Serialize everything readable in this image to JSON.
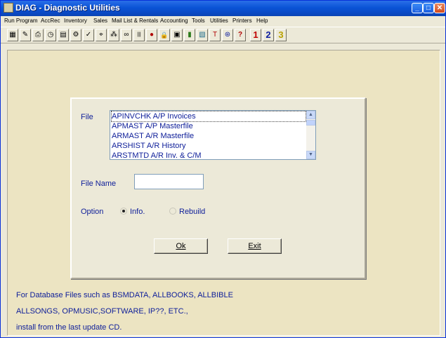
{
  "window": {
    "title": "DIAG - Diagnostic Utilities"
  },
  "caption": {
    "minimize": "_",
    "maximize": "□",
    "close": "✕"
  },
  "menu": [
    "Run Program",
    "AccRec",
    "Inventory",
    "Sales",
    "Mail List & Rentals",
    "Accounting",
    "Tools",
    "Utilities",
    "Printers",
    "Help"
  ],
  "toolbar": {
    "icons": [
      "calculator-icon",
      "folder-icon",
      "printer-icon",
      "clock-icon",
      "ledger-icon",
      "settings-icon",
      "checkmark-icon",
      "binoculars-icon",
      "network-icon",
      "glasses-icon",
      "barcode-icon",
      "record-icon",
      "lock-icon",
      "card-icon",
      "chart-icon",
      "picture-icon",
      "stamp-icon",
      "disk-icon",
      "help-icon"
    ],
    "glyphs": [
      "▦",
      "✎",
      "⎙",
      "◷",
      "▤",
      "⚙",
      "✓",
      "⌖",
      "⁂",
      "∞",
      "|||",
      "●",
      "🔒",
      "▣",
      "▮",
      "▧",
      "T",
      "⊛",
      "?"
    ],
    "numbers": [
      "1",
      "2",
      "3"
    ],
    "number_colors": [
      "#C00000",
      "#1020A0",
      "#B8A000"
    ]
  },
  "dialog": {
    "file_label": "File",
    "files": [
      "APINVCHK A/P Invoices",
      "APMAST A/P Masterfile",
      "ARMAST A/R Masterfile",
      "ARSHIST  A/R History",
      "ARSTMTD  A/R Inv. & C/M"
    ],
    "scroll_up": "▲",
    "scroll_down": "▼",
    "file_name_label": "File Name",
    "file_name_value": "",
    "option_label": "Option",
    "option_info": "Info.",
    "option_rebuild": "Rebuild",
    "ok_label": "Ok",
    "exit_label": "Exit"
  },
  "note": {
    "line1": "For Database Files such as BSMDATA, ALLBOOKS, ALLBIBLE",
    "line2": "ALLSONGS, OPMUSIC,SOFTWARE, IP??, ETC.,",
    "line3": "install from the last update CD."
  }
}
